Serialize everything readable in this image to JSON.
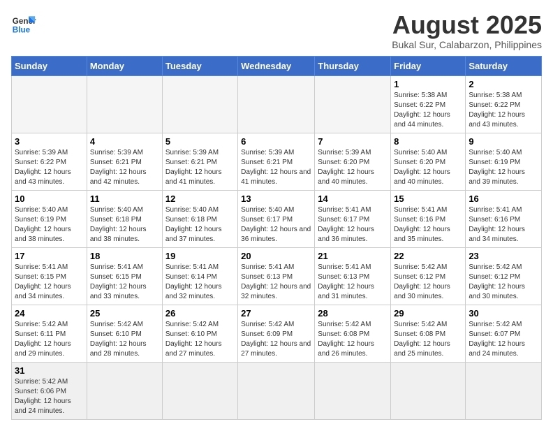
{
  "logo": {
    "line1": "General",
    "line2": "Blue"
  },
  "title": "August 2025",
  "subtitle": "Bukal Sur, Calabarzon, Philippines",
  "weekdays": [
    "Sunday",
    "Monday",
    "Tuesday",
    "Wednesday",
    "Thursday",
    "Friday",
    "Saturday"
  ],
  "weeks": [
    [
      {
        "day": "",
        "info": ""
      },
      {
        "day": "",
        "info": ""
      },
      {
        "day": "",
        "info": ""
      },
      {
        "day": "",
        "info": ""
      },
      {
        "day": "",
        "info": ""
      },
      {
        "day": "1",
        "info": "Sunrise: 5:38 AM\nSunset: 6:22 PM\nDaylight: 12 hours and 44 minutes."
      },
      {
        "day": "2",
        "info": "Sunrise: 5:38 AM\nSunset: 6:22 PM\nDaylight: 12 hours and 43 minutes."
      }
    ],
    [
      {
        "day": "3",
        "info": "Sunrise: 5:39 AM\nSunset: 6:22 PM\nDaylight: 12 hours and 43 minutes."
      },
      {
        "day": "4",
        "info": "Sunrise: 5:39 AM\nSunset: 6:21 PM\nDaylight: 12 hours and 42 minutes."
      },
      {
        "day": "5",
        "info": "Sunrise: 5:39 AM\nSunset: 6:21 PM\nDaylight: 12 hours and 41 minutes."
      },
      {
        "day": "6",
        "info": "Sunrise: 5:39 AM\nSunset: 6:21 PM\nDaylight: 12 hours and 41 minutes."
      },
      {
        "day": "7",
        "info": "Sunrise: 5:39 AM\nSunset: 6:20 PM\nDaylight: 12 hours and 40 minutes."
      },
      {
        "day": "8",
        "info": "Sunrise: 5:40 AM\nSunset: 6:20 PM\nDaylight: 12 hours and 40 minutes."
      },
      {
        "day": "9",
        "info": "Sunrise: 5:40 AM\nSunset: 6:19 PM\nDaylight: 12 hours and 39 minutes."
      }
    ],
    [
      {
        "day": "10",
        "info": "Sunrise: 5:40 AM\nSunset: 6:19 PM\nDaylight: 12 hours and 38 minutes."
      },
      {
        "day": "11",
        "info": "Sunrise: 5:40 AM\nSunset: 6:18 PM\nDaylight: 12 hours and 38 minutes."
      },
      {
        "day": "12",
        "info": "Sunrise: 5:40 AM\nSunset: 6:18 PM\nDaylight: 12 hours and 37 minutes."
      },
      {
        "day": "13",
        "info": "Sunrise: 5:40 AM\nSunset: 6:17 PM\nDaylight: 12 hours and 36 minutes."
      },
      {
        "day": "14",
        "info": "Sunrise: 5:41 AM\nSunset: 6:17 PM\nDaylight: 12 hours and 36 minutes."
      },
      {
        "day": "15",
        "info": "Sunrise: 5:41 AM\nSunset: 6:16 PM\nDaylight: 12 hours and 35 minutes."
      },
      {
        "day": "16",
        "info": "Sunrise: 5:41 AM\nSunset: 6:16 PM\nDaylight: 12 hours and 34 minutes."
      }
    ],
    [
      {
        "day": "17",
        "info": "Sunrise: 5:41 AM\nSunset: 6:15 PM\nDaylight: 12 hours and 34 minutes."
      },
      {
        "day": "18",
        "info": "Sunrise: 5:41 AM\nSunset: 6:15 PM\nDaylight: 12 hours and 33 minutes."
      },
      {
        "day": "19",
        "info": "Sunrise: 5:41 AM\nSunset: 6:14 PM\nDaylight: 12 hours and 32 minutes."
      },
      {
        "day": "20",
        "info": "Sunrise: 5:41 AM\nSunset: 6:13 PM\nDaylight: 12 hours and 32 minutes."
      },
      {
        "day": "21",
        "info": "Sunrise: 5:41 AM\nSunset: 6:13 PM\nDaylight: 12 hours and 31 minutes."
      },
      {
        "day": "22",
        "info": "Sunrise: 5:42 AM\nSunset: 6:12 PM\nDaylight: 12 hours and 30 minutes."
      },
      {
        "day": "23",
        "info": "Sunrise: 5:42 AM\nSunset: 6:12 PM\nDaylight: 12 hours and 30 minutes."
      }
    ],
    [
      {
        "day": "24",
        "info": "Sunrise: 5:42 AM\nSunset: 6:11 PM\nDaylight: 12 hours and 29 minutes."
      },
      {
        "day": "25",
        "info": "Sunrise: 5:42 AM\nSunset: 6:10 PM\nDaylight: 12 hours and 28 minutes."
      },
      {
        "day": "26",
        "info": "Sunrise: 5:42 AM\nSunset: 6:10 PM\nDaylight: 12 hours and 27 minutes."
      },
      {
        "day": "27",
        "info": "Sunrise: 5:42 AM\nSunset: 6:09 PM\nDaylight: 12 hours and 27 minutes."
      },
      {
        "day": "28",
        "info": "Sunrise: 5:42 AM\nSunset: 6:08 PM\nDaylight: 12 hours and 26 minutes."
      },
      {
        "day": "29",
        "info": "Sunrise: 5:42 AM\nSunset: 6:08 PM\nDaylight: 12 hours and 25 minutes."
      },
      {
        "day": "30",
        "info": "Sunrise: 5:42 AM\nSunset: 6:07 PM\nDaylight: 12 hours and 24 minutes."
      }
    ],
    [
      {
        "day": "31",
        "info": "Sunrise: 5:42 AM\nSunset: 6:06 PM\nDaylight: 12 hours and 24 minutes."
      },
      {
        "day": "",
        "info": ""
      },
      {
        "day": "",
        "info": ""
      },
      {
        "day": "",
        "info": ""
      },
      {
        "day": "",
        "info": ""
      },
      {
        "day": "",
        "info": ""
      },
      {
        "day": "",
        "info": ""
      }
    ]
  ]
}
